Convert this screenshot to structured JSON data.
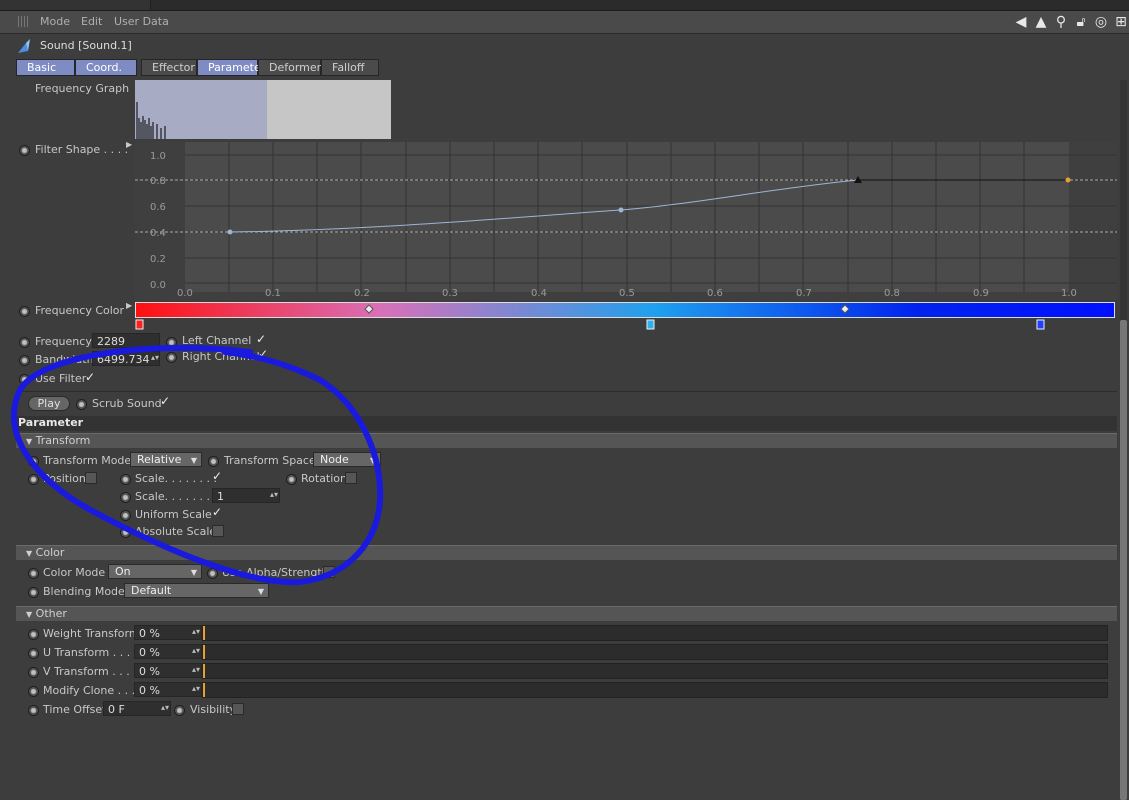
{
  "menu": {
    "items": [
      "Mode",
      "Edit",
      "User Data"
    ]
  },
  "object": {
    "title": "Sound [Sound.1]"
  },
  "tabs": [
    "Basic",
    "Coord.",
    "Effector",
    "Parameter",
    "Deformer",
    "Falloff"
  ],
  "sound": {
    "freq_graph_label": "Frequency Graph",
    "filter_shape_label": "Filter Shape . . . .",
    "freq_color_label": "Frequency Color",
    "frequency_label": "Frequency",
    "frequency_value": "2289",
    "left_channel_label": "Left Channel",
    "bandwidth_label": "Bandwidth",
    "bandwidth_value": "6499.734",
    "right_channel_label": "Right Channel",
    "use_filter_label": "Use Filter",
    "play_label": "Play",
    "scrub_label": "Scrub Sound"
  },
  "curve": {
    "y_ticks": [
      "1.0",
      "0.8",
      "0.6",
      "0.4",
      "0.2",
      "0.0"
    ],
    "x_ticks": [
      "0.0",
      "0.1",
      "0.2",
      "0.3",
      "0.4",
      "0.5",
      "0.6",
      "0.7",
      "0.8",
      "0.9",
      "1.0"
    ]
  },
  "parameter": {
    "header": "Parameter",
    "transform_section": "Transform",
    "transform_mode_label": "Transform Mode",
    "transform_mode_value": "Relative",
    "transform_space_label": "Transform Space",
    "transform_space_value": "Node",
    "position_label": "Position",
    "scale_label": "Scale. . . . . . . .",
    "rotation_label": "Rotation",
    "scale_value_label": "Scale. . . . . . . .",
    "scale_value": "1",
    "uniform_scale_label": "Uniform Scale",
    "absolute_scale_label": "Absolute Scale",
    "color_section": "Color",
    "color_mode_label": "Color Mode",
    "color_mode_value": "On",
    "use_alpha_label": "Use Alpha/Strength",
    "blending_mode_label": "Blending Mode",
    "blending_mode_value": "Default",
    "other_section": "Other",
    "weight_label": "Weight Transform",
    "weight_value": "0 %",
    "u_label": "U Transform . . . .",
    "u_value": "0 %",
    "v_label": "V Transform . . . .",
    "v_value": "0 %",
    "modify_label": "Modify Clone . . .",
    "modify_value": "0 %",
    "time_offset_label": "Time Offset",
    "time_offset_value": "0 F",
    "visibility_label": "Visibility"
  },
  "colors": {
    "accent": "#7f8cc4",
    "annotation": "#1a1adf"
  }
}
